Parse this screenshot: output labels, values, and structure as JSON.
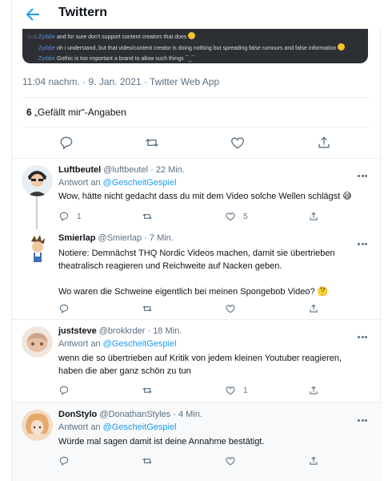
{
  "header": {
    "title": "Twittern"
  },
  "embed": {
    "lines": [
      {
        "time": "12:36",
        "user": "Zyddie",
        "text": "and for sure don't support content creators that does"
      },
      {
        "time": "",
        "user": "Zyddie",
        "text": "oh i understand, but that video/content creator is doing nothing but spreading false rumours and false information"
      },
      {
        "time": "",
        "user": "Zyddie",
        "text": "Gothic is too important a brand to allow such things ¯_¯"
      }
    ]
  },
  "main_tweet": {
    "timestamp": "11:04 nachm. · 9. Jan. 2021 · Twitter Web App",
    "likes_count": "6",
    "likes_label": "„Gefällt mir“-Angaben"
  },
  "replies": [
    {
      "name": "Luftbeutel",
      "handle": "@luftbeutel",
      "time": "· 22 Min.",
      "reply_prefix": "Antwort an ",
      "reply_to": "@GescheitGespiel",
      "text": "Wow, hätte nicht gedacht dass du mit dem Video solche Wellen schlägst 😅",
      "replies": "1",
      "retweets": "",
      "likes": "5"
    },
    {
      "name": "Smierlap",
      "handle": "@Smierlap",
      "time": "· 7 Min.",
      "text_lines": [
        "Notiere: Demnächst THQ Nordic Videos machen, damit sie übertrieben",
        "theatralisch reagieren und Reichweite auf Nacken geben.",
        "",
        "Wo waren die Schweine eigentlich bei meinen Spongebob Video? 🤔"
      ]
    },
    {
      "name": "juststeve",
      "handle": "@brokkrder",
      "time": "· 18 Min.",
      "reply_prefix": "Antwort an ",
      "reply_to": "@GescheitGespiel",
      "text_lines": [
        "wenn die so übertrieben auf Kritik von jedem kleinen Youtuber reagieren,",
        "haben die aber ganz schön zu tun"
      ],
      "likes": "1"
    },
    {
      "name": "DonStylo",
      "handle": "@DonathanStyles",
      "time": "· 4 Min.",
      "reply_prefix": "Antwort an ",
      "reply_to": "@GescheitGespiel",
      "text": "Würde mal sagen damit ist deine Annahme bestätigt."
    }
  ],
  "colors": {
    "accent": "#1d9bf0",
    "secondary_text": "#5b7083",
    "embed_bg": "#2c2f33"
  }
}
